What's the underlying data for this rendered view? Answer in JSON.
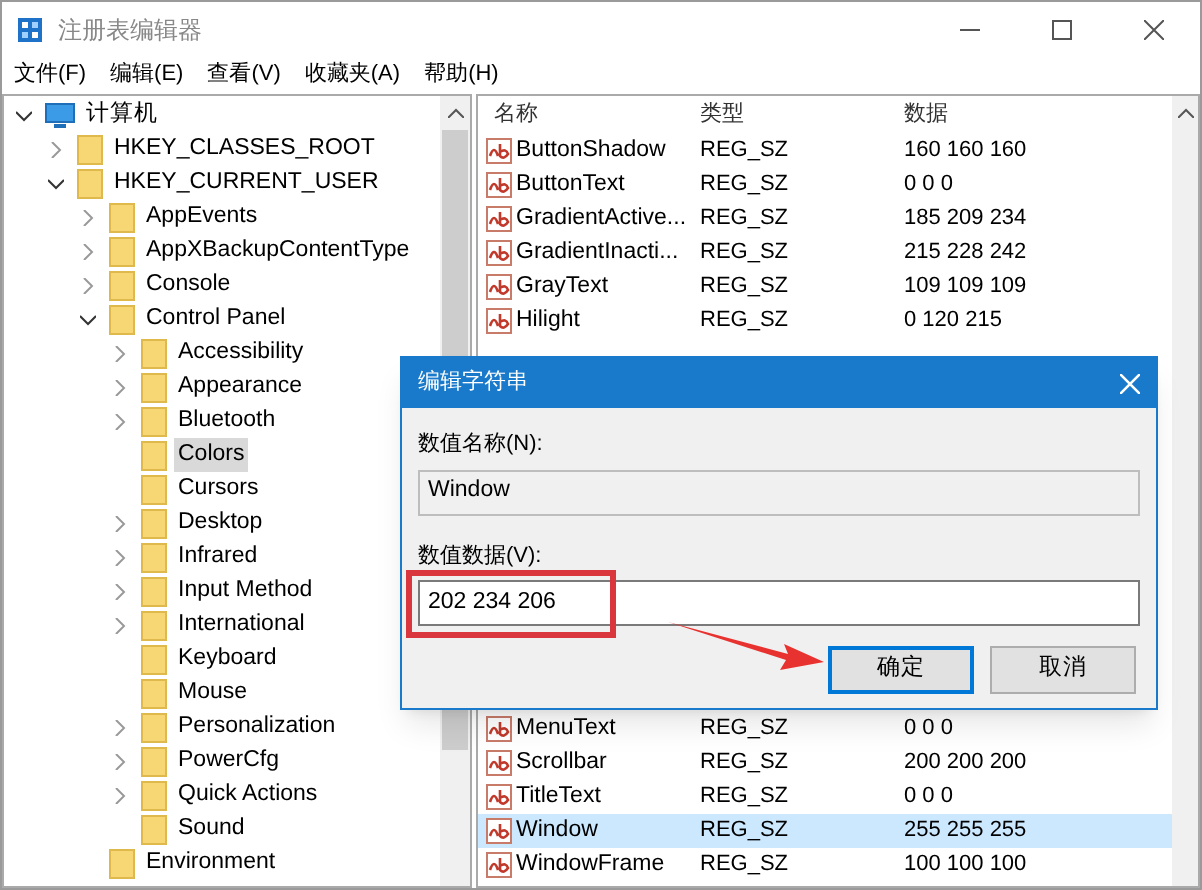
{
  "window": {
    "title": "注册表编辑器"
  },
  "menu": [
    {
      "label": "文件(F)"
    },
    {
      "label": "编辑(E)"
    },
    {
      "label": "查看(V)"
    },
    {
      "label": "收藏夹(A)"
    },
    {
      "label": "帮助(H)"
    }
  ],
  "tree": [
    {
      "label": "计算机",
      "kind": "computer",
      "expanded": true,
      "selected": false,
      "children": [
        {
          "label": "HKEY_CLASSES_ROOT",
          "expanded": false,
          "selected": false
        },
        {
          "label": "HKEY_CURRENT_USER",
          "expanded": true,
          "selected": false,
          "children": [
            {
              "label": "AppEvents",
              "expanded": false,
              "selected": false
            },
            {
              "label": "AppXBackupContentType",
              "expanded": false,
              "selected": false
            },
            {
              "label": "Console",
              "expanded": false,
              "selected": false
            },
            {
              "label": "Control Panel",
              "expanded": true,
              "selected": false,
              "children": [
                {
                  "label": "Accessibility",
                  "expanded": false,
                  "selected": false
                },
                {
                  "label": "Appearance",
                  "expanded": false,
                  "selected": false
                },
                {
                  "label": "Bluetooth",
                  "expanded": false,
                  "selected": false
                },
                {
                  "label": "Colors",
                  "selected": true
                },
                {
                  "label": "Cursors",
                  "selected": false
                },
                {
                  "label": "Desktop",
                  "expanded": false,
                  "selected": false
                },
                {
                  "label": "Infrared",
                  "expanded": false,
                  "selected": false
                },
                {
                  "label": "Input Method",
                  "expanded": false,
                  "selected": false
                },
                {
                  "label": "International",
                  "expanded": false,
                  "selected": false
                },
                {
                  "label": "Keyboard",
                  "selected": false
                },
                {
                  "label": "Mouse",
                  "selected": false
                },
                {
                  "label": "Personalization",
                  "expanded": false,
                  "selected": false
                },
                {
                  "label": "PowerCfg",
                  "expanded": false,
                  "selected": false
                },
                {
                  "label": "Quick Actions",
                  "expanded": false,
                  "selected": false
                },
                {
                  "label": "Sound",
                  "selected": false
                }
              ]
            },
            {
              "label": "Environment",
              "selected": false
            }
          ]
        }
      ]
    }
  ],
  "values": {
    "columns": [
      "名称",
      "类型",
      "数据"
    ],
    "rows_top": [
      {
        "name": "ButtonShadow",
        "type": "REG_SZ",
        "data": "160 160 160",
        "selected": false
      },
      {
        "name": "ButtonText",
        "type": "REG_SZ",
        "data": "0 0 0",
        "selected": false
      },
      {
        "name": "GradientActive...",
        "type": "REG_SZ",
        "data": "185 209 234",
        "selected": false
      },
      {
        "name": "GradientInacti...",
        "type": "REG_SZ",
        "data": "215 228 242",
        "selected": false
      },
      {
        "name": "GrayText",
        "type": "REG_SZ",
        "data": "109 109 109",
        "selected": false
      },
      {
        "name": "Hilight",
        "type": "REG_SZ",
        "data": "0 120 215",
        "selected": false
      }
    ],
    "rows_bottom": [
      {
        "name": "MenuText",
        "type": "REG_SZ",
        "data": "0 0 0",
        "selected": false
      },
      {
        "name": "Scrollbar",
        "type": "REG_SZ",
        "data": "200 200 200",
        "selected": false
      },
      {
        "name": "TitleText",
        "type": "REG_SZ",
        "data": "0 0 0",
        "selected": false
      },
      {
        "name": "Window",
        "type": "REG_SZ",
        "data": "255 255 255",
        "selected": true
      },
      {
        "name": "WindowFrame",
        "type": "REG_SZ",
        "data": "100 100 100",
        "selected": false
      }
    ]
  },
  "dialog": {
    "title": "编辑字符串",
    "fields": [
      {
        "label": "数值名称(N):",
        "value": "Window",
        "kind": "readonly",
        "annotated": false
      },
      {
        "label": "数值数据(V):",
        "value": "202 234 206",
        "kind": "editable",
        "annotated": true
      }
    ],
    "buttons": [
      {
        "label": "确定",
        "focused": true,
        "annotated": true
      },
      {
        "label": "取消",
        "focused": false,
        "annotated": false
      }
    ]
  }
}
